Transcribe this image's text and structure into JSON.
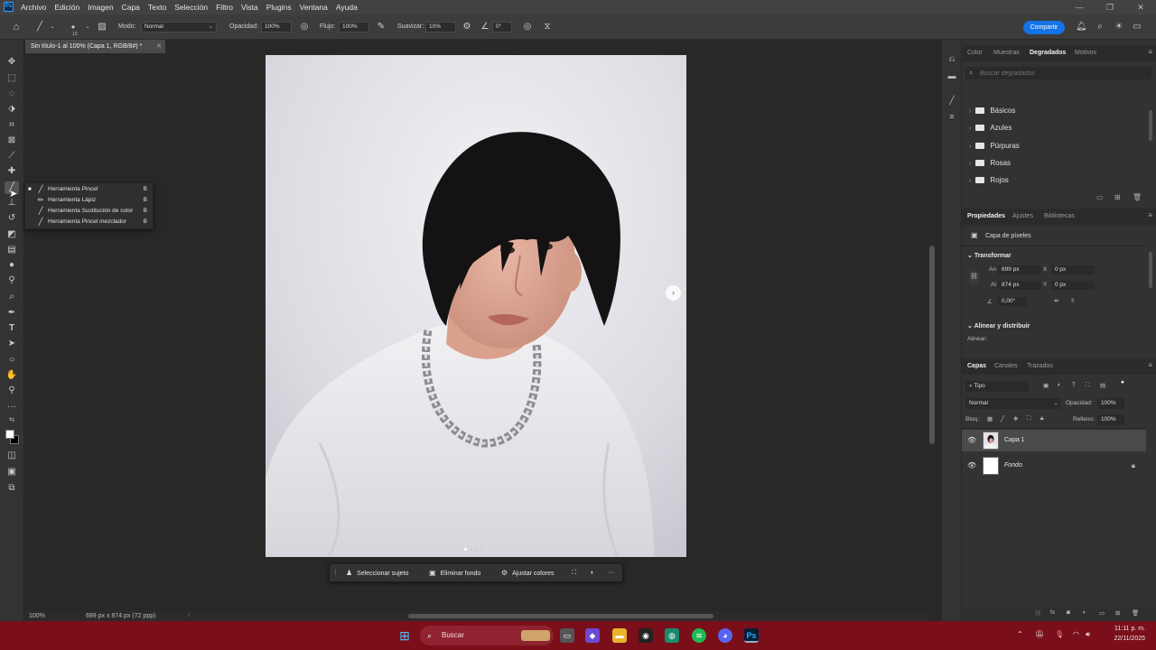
{
  "menubar": {
    "app_icon": "Ps",
    "items": [
      "Archivo",
      "Edición",
      "Imagen",
      "Capa",
      "Texto",
      "Selección",
      "Filtro",
      "Vista",
      "Plugins",
      "Ventana",
      "Ayuda"
    ]
  },
  "options": {
    "brush_size": "10",
    "mode_label": "Modo:",
    "mode_value": "Normal",
    "opacity_label": "Opacidad:",
    "opacity_value": "100%",
    "flow_label": "Flujo:",
    "flow_value": "100%",
    "smooth_label": "Suavizar:",
    "smooth_value": "10%",
    "angle_value": "0°",
    "share_label": "Compartir"
  },
  "document": {
    "tab_title": "Sin título-1 al 100% (Capa 1, RGB/8#) *",
    "zoom": "100%",
    "size_info": "699 px x 874 px (72 ppp)"
  },
  "flyout": {
    "items": [
      {
        "label": "Herramienta Pincel",
        "key": "B",
        "active": true
      },
      {
        "label": "Herramienta Lápiz",
        "key": "B",
        "active": false
      },
      {
        "label": "Herramienta Sustitución de color",
        "key": "B",
        "active": false
      },
      {
        "label": "Herramienta Pincel mezclador",
        "key": "B",
        "active": false
      }
    ]
  },
  "context_bar": {
    "select_subject": "Seleccionar sujeto",
    "remove_bg": "Eliminar fondo",
    "adjust_colors": "Ajustar colores"
  },
  "gradients_panel": {
    "tabs": [
      "Color",
      "Muestras",
      "Degradados",
      "Motivos"
    ],
    "active_tab": "Degradados",
    "search_placeholder": "Buscar degradados",
    "folders": [
      "Básicos",
      "Azules",
      "Púrpuras",
      "Rosas",
      "Rojos"
    ]
  },
  "properties_panel": {
    "tabs": [
      "Propiedades",
      "Ajustes",
      "Bibliotecas"
    ],
    "active_tab": "Propiedades",
    "layer_type": "Capa de píxeles",
    "transform_title": "Transformar",
    "w_label": "An",
    "w_value": "699 px",
    "h_label": "Al",
    "h_value": "874 px",
    "x_label": "X",
    "x_value": "0 px",
    "y_label": "Y",
    "y_value": "0 px",
    "angle_value": "0,00°",
    "align_title": "Alinear y distribuir",
    "align_label": "Alinear:"
  },
  "layers_panel": {
    "tabs": [
      "Capas",
      "Canales",
      "Trazados"
    ],
    "active_tab": "Capas",
    "filter_label": "Tipo",
    "blend_mode": "Normal",
    "opacity_label": "Opacidad:",
    "opacity_value": "100%",
    "lock_label": "Bloq.:",
    "fill_label": "Relleno:",
    "fill_value": "100%",
    "layers": [
      {
        "name": "Capa 1",
        "selected": true,
        "locked": false
      },
      {
        "name": "Fondo",
        "selected": false,
        "locked": true
      }
    ]
  },
  "win_taskbar": {
    "search_label": "Buscar",
    "time": "11:11 p. m.",
    "date": "22/11/2025"
  },
  "colors": {
    "accent": "#1473e6",
    "taskbar": "#7a0f1a",
    "panel_bg": "#323232",
    "canvas_bg": "#282828"
  }
}
